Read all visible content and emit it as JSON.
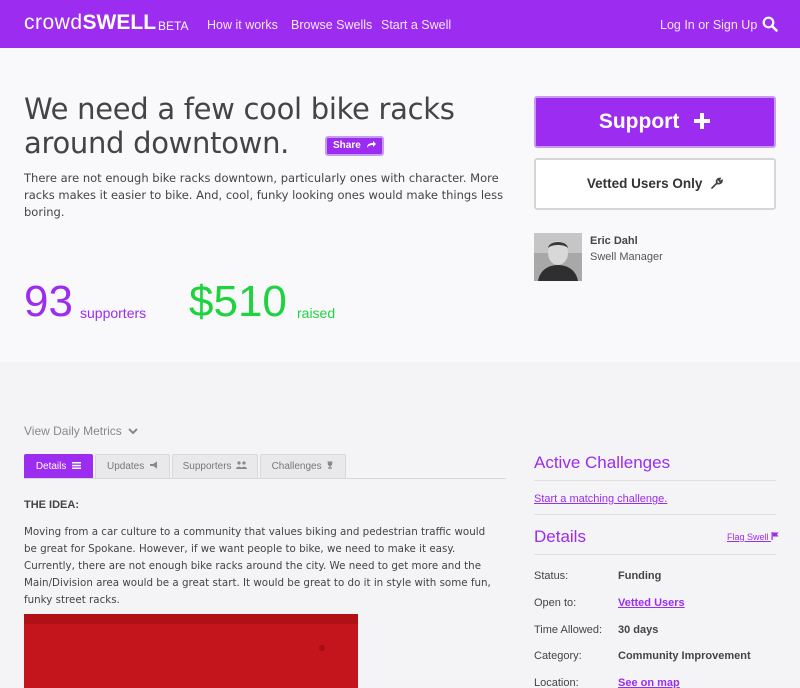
{
  "brand": {
    "logo_text": "crowdswell",
    "beta": "BETA"
  },
  "nav": {
    "links": [
      "How it works",
      "Browse Swells",
      "Start a Swell"
    ],
    "login": "Log In or Sign Up",
    "search_icon": "search-icon"
  },
  "swell": {
    "title": "We need a few cool bike racks around downtown.",
    "share_label": "Share",
    "description": "There are not enough bike racks downtown, particularly ones with character. More racks makes it easier to bike. And, cool, funky looking ones would make things less boring.",
    "supporters_count": "93",
    "supporters_label": "supporters",
    "raised_amount": "$510",
    "raised_label": "raised"
  },
  "actions": {
    "support_label": "Support",
    "vetted_label": "Vetted Users Only"
  },
  "manager": {
    "name": "Eric Dahl",
    "role": "Swell Manager"
  },
  "metrics_toggle": "View Daily Metrics",
  "tabs": [
    {
      "label": "Details",
      "icon": "list-icon",
      "active": true
    },
    {
      "label": "Updates",
      "icon": "megaphone-icon",
      "active": false
    },
    {
      "label": "Supporters",
      "icon": "users-icon",
      "active": false
    },
    {
      "label": "Challenges",
      "icon": "trophy-icon",
      "active": false
    }
  ],
  "idea": {
    "heading": "THE IDEA:",
    "body": "Moving from a car culture to a community that values biking and pedestrian traffic would be great for Spokane. However, if we want people to bike, we need to make it easy. Currently, there are not enough bike racks around the city. We need to get more and the Main/Division area would be a great start. It would be great to do it in style with some fun, funky street racks."
  },
  "sidebar": {
    "challenges_heading": "Active Challenges",
    "matching_link": "Start a matching challenge.",
    "details_heading": "Details",
    "flag_label": "Flag Swell",
    "details": [
      {
        "label": "Status:",
        "value": "Funding",
        "link": false
      },
      {
        "label": "Open to:",
        "value": "Vetted Users",
        "link": true
      },
      {
        "label": "Time Allowed:",
        "value": "30 days",
        "link": false
      },
      {
        "label": "Category:",
        "value": "Community Improvement",
        "link": false
      },
      {
        "label": "Location:",
        "value": "See on map",
        "link": true
      }
    ]
  },
  "colors": {
    "brand": "#9b2cf0",
    "raised": "#1fd33f",
    "image_red": "#c3151b"
  }
}
